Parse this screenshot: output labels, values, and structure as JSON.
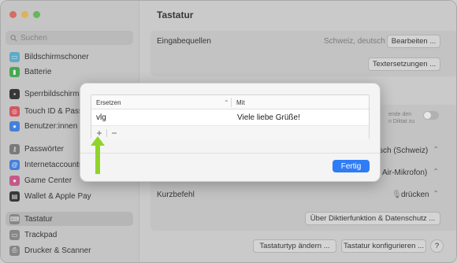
{
  "sidebar": {
    "search_placeholder": "Suchen",
    "items": [
      {
        "label": "Bildschirmschoner",
        "icon": "screensaver-icon",
        "color": "#55b8d9"
      },
      {
        "label": "Batterie",
        "icon": "battery-icon",
        "color": "#3cb34a"
      },
      {
        "label": "Sperrbildschirm",
        "icon": "lock-icon",
        "color": "#2a2a2a"
      },
      {
        "label": "Touch ID & Passwort",
        "icon": "fingerprint-icon",
        "color": "#ea4d5a"
      },
      {
        "label": "Benutzer:innen & Gruppen",
        "icon": "users-icon",
        "color": "#3a82f0"
      },
      {
        "label": "Passwörter",
        "icon": "key-icon",
        "color": "#7a7a7a"
      },
      {
        "label": "Internetaccounts",
        "icon": "at-icon",
        "color": "#3a82f0"
      },
      {
        "label": "Game Center",
        "icon": "game-center-icon",
        "color": "#d6518c"
      },
      {
        "label": "Wallet & Apple Pay",
        "icon": "wallet-icon",
        "color": "#2a2a2a"
      },
      {
        "label": "Tastatur",
        "icon": "keyboard-icon",
        "color": "#8a8a8a"
      },
      {
        "label": "Trackpad",
        "icon": "trackpad-icon",
        "color": "#8a8a8a"
      },
      {
        "label": "Drucker & Scanner",
        "icon": "printer-icon",
        "color": "#8a8a8a"
      }
    ]
  },
  "main": {
    "title": "Tastatur",
    "eingabequellen_label": "Eingabequellen",
    "eingabequellen_value": "Schweiz, deutsch",
    "bearbeiten_btn": "Bearbeiten ...",
    "textersetzungen_btn": "Textersetzungen ...",
    "diktat_hint_line1": "ende den",
    "diktat_hint_line2": "n Diktat zu",
    "language_value": "sch (Schweiz)",
    "mic_value": "Air-Mikrofon)",
    "kurzbefehl_label": "Kurzbefehl",
    "kurzbefehl_value": "drücken",
    "ueber_diktier_btn": "Über Diktierfunktion & Datenschutz ...",
    "tastaturtyp_btn": "Tastaturtyp ändern ...",
    "konfigurieren_btn": "Tastatur konfigurieren ...",
    "help_btn": "?"
  },
  "dialog": {
    "col_replace": "Ersetzen",
    "col_with": "Mit",
    "rows": [
      {
        "replace": "vlg",
        "with": "Viele liebe Grüße!"
      }
    ],
    "add_btn": "+",
    "remove_btn": "−",
    "done_btn": "Fertig"
  },
  "colors": {
    "accent": "#2f7cf6",
    "arrow": "#8fd42a"
  }
}
